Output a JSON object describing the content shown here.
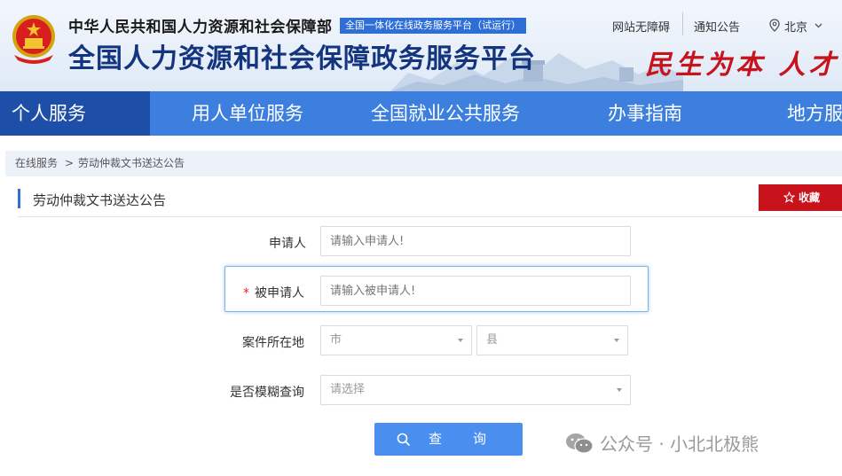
{
  "header": {
    "org_name": "中华人民共和国人力资源和社会保障部",
    "platform_tag": "全国一体化在线政务服务平台（试运行）",
    "platform_title": "全国人力资源和社会保障政务服务平台",
    "top_links": {
      "accessibility": "网站无障碍",
      "notice": "通知公告",
      "location": "北京"
    },
    "slogan": "民生为本 人才优"
  },
  "nav": {
    "items": [
      {
        "label": "个人服务",
        "active": true
      },
      {
        "label": "用人单位服务",
        "active": false
      },
      {
        "label": "全国就业公共服务",
        "active": false
      },
      {
        "label": "办事指南",
        "active": false
      },
      {
        "label": "地方服务",
        "active": false
      }
    ]
  },
  "breadcrumb": {
    "home": "在线服务",
    "separator": ">",
    "current": "劳动仲裁文书送达公告"
  },
  "section": {
    "title": "劳动仲裁文书送达公告",
    "favorite_label": "收藏"
  },
  "form": {
    "applicant": {
      "label": "申请人",
      "placeholder": "请输入申请人!"
    },
    "respondent": {
      "required_mark": "*",
      "label": "被申请人",
      "placeholder": "请输入被申请人!"
    },
    "location": {
      "label": "案件所在地",
      "city_value": "市",
      "county_value": "县"
    },
    "fuzzy": {
      "label": "是否模糊查询",
      "value": "请选择"
    },
    "search_label_1": "查",
    "search_label_2": "询"
  },
  "watermark": {
    "text": "公众号 · 小北北极熊"
  },
  "colors": {
    "nav_bg": "#3d7fdf",
    "nav_active": "#1d4ea8",
    "title_blue": "#13347e",
    "accent_red": "#c8131c",
    "button_blue": "#4a8ef0"
  }
}
